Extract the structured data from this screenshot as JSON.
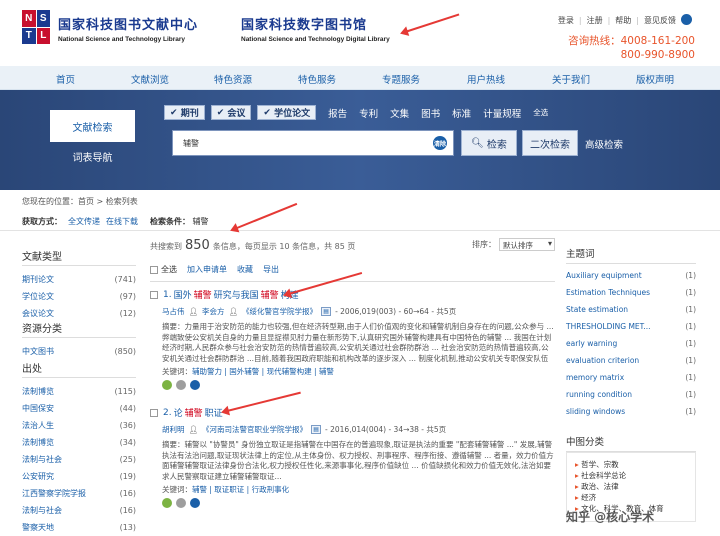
{
  "header": {
    "logo_letters": [
      "N",
      "S",
      "T",
      "L"
    ],
    "title_library": "国家科技图书文献中心",
    "title_library_en": "National Science and Technology Library",
    "title_digital": "国家科技数字图书馆",
    "title_digital_en": "National Science and Technology Digital Library",
    "top_links": [
      "登录",
      "注册",
      "帮助",
      "意见反馈"
    ],
    "hotline_label": "咨询热线：4008-161-200",
    "hotline_2": "800-990-8900"
  },
  "nav": [
    "首页",
    "文献浏览",
    "特色资源",
    "特色服务",
    "专题服务",
    "用户热线",
    "关于我们",
    "版权声明"
  ],
  "search": {
    "tab_active": "文献检索",
    "tab_2": "词表导航",
    "types_checked": [
      "期刊",
      "会议",
      "学位论文"
    ],
    "types_plain": [
      "报告",
      "专利",
      "文集",
      "图书",
      "标准",
      "计量规程"
    ],
    "select_all": "全选",
    "query": "辅警",
    "clear_label": "清除",
    "search_btn": "检索",
    "secondary_btn": "二次检索",
    "advanced": "高级检索"
  },
  "breadcrumb": "您现在的位置：首页 > 检索列表",
  "access": {
    "label": "获取方式：",
    "options": [
      "全文传递",
      "在线下载"
    ]
  },
  "condition": {
    "label": "检索条件：",
    "value": "辅警"
  },
  "facets": [
    {
      "title": "文献类型",
      "items": [
        {
          "name": "期刊论文",
          "count": "(741)"
        },
        {
          "name": "学位论文",
          "count": "(97)"
        },
        {
          "name": "会议论文",
          "count": "(12)"
        }
      ]
    },
    {
      "title": "资源分类",
      "items": [
        {
          "name": "中文图书",
          "count": "(850)"
        }
      ]
    },
    {
      "title": "出处",
      "items": [
        {
          "name": "法制博览",
          "count": "(115)"
        },
        {
          "name": "中国保安",
          "count": "(44)"
        },
        {
          "name": "法治人生",
          "count": "(36)"
        },
        {
          "name": "法制博览",
          "count": "(34)"
        },
        {
          "name": "法制与社会",
          "count": "(25)"
        },
        {
          "name": "公安研究",
          "count": "(19)"
        },
        {
          "name": "江西警察学院学报",
          "count": "(16)"
        },
        {
          "name": "法制与社会",
          "count": "(16)"
        },
        {
          "name": "警察天地",
          "count": "(13)"
        }
      ]
    }
  ],
  "results_header": {
    "prefix": "共搜索到",
    "total": "850",
    "suffix": "条信息，每页显示 10 条信息，共 85 页",
    "sort_label": "排序：",
    "sort_value": "默认排序"
  },
  "actions": {
    "select_all": "全选",
    "add_list": "加入申请单",
    "favorite": "收藏",
    "export": "导出"
  },
  "results": [
    {
      "num": "1.",
      "title_pre": "国外",
      "title_hl1": "辅警",
      "title_mid": "研究与我国",
      "title_hl2": "辅警",
      "title_post": "构建",
      "author": "马占伟",
      "author2": "李会方",
      "source": "《绥化警官学院学报》",
      "date": "- 2006,019(003) - 60→64 - 共5页",
      "abstract": "摘要：力量用于治安防范的能力也较强,但在经济转型期,由于人们价值观的变化和辅警机制自身存在的问题,公众参与 ...弊端致使公安机关自身的力量且显捉襟见肘力量在新形势下,认真研究国外辅警构建具有中国特色的辅警 ... 我国在计划经济时期,人民群众参与社会治安防范的热情普遍较高,公安机关通过社会群防群治 ... 社会治安防范的热情普遍较高,公安机关通过社会群防群治 ...目前,随着我国政府职能和机构改革的逐步深入 ... 制度化机制,推动公安机关专职保安队伍建设的重要保障...",
      "keywords_label": "关键词：",
      "keywords": "辅助警力 | 国外辅警 | 现代辅警构建 | 辅警"
    },
    {
      "num": "2.",
      "title_pre": "论",
      "title_hl1": "辅警",
      "title_mid": "职证",
      "title_hl2": "",
      "title_post": "",
      "author": "胡利明",
      "author2": "",
      "source": "《河南司法警官职业学院学报》",
      "date": "- 2016,014(004) - 34→38 - 共5页",
      "abstract": "摘要：辅警以 \"协警员\" 身份独立取证是指辅警在中国存在的普遍现象,取证是执法的重要 \"配套辅警辅警 ...\" 发展,辅警执法有法治问题,取证现状法律上的定位,从主体身份、权力授权、刑事程序、程序衔接、遵循辅警 ... 者量，效力价值方面辅警辅警取证法律身份合法化,权力授权任性化,来源事事化,程序价值缺位 ... 价值缺损化和效力价值无效化,法治如要求人民警察取证建立辅警辅警取证...",
      "keywords_label": "关键词：",
      "keywords": "辅警 | 取证职证 | 行政刑事化"
    }
  ],
  "topics": {
    "title": "主题词",
    "items": [
      {
        "name": "Auxiliary equipment",
        "count": "(1)"
      },
      {
        "name": "Estimation Techniques",
        "count": "(1)"
      },
      {
        "name": "State estimation",
        "count": "(1)"
      },
      {
        "name": "THRESHOLDING MET...",
        "count": "(1)"
      },
      {
        "name": "early warning",
        "count": "(1)"
      },
      {
        "name": "evaluation criterion",
        "count": "(1)"
      },
      {
        "name": "memory matrix",
        "count": "(1)"
      },
      {
        "name": "running condition",
        "count": "(1)"
      },
      {
        "name": "sliding windows",
        "count": "(1)"
      }
    ]
  },
  "classification": {
    "title": "中图分类",
    "items": [
      "哲学、宗教",
      "社会科学总论",
      "政治、法律",
      "经济",
      "文化、科学、教育、体育"
    ]
  },
  "watermark": "知乎 @核心学术"
}
